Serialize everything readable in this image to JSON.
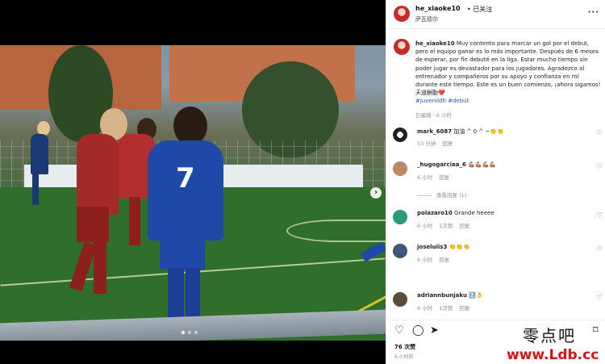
{
  "post": {
    "username": "he_xiaoke10",
    "follow_label": "已关注",
    "separator": "•",
    "location": "萨瓦德尔",
    "caption": "Muy contento para marcar un gol por el debut, pero el equipo ganar es lo más importante. Después de 6 meses de esperar, por fin debuté en la liga. Estar mucho tiempo sin poder jugar es devastador para los jugadores. Agradezco al entrenador y compañeros por su apoyo y confianza en mí durante este tiempo. Este es un buen comienzo, ¡ahora sigamos!",
    "caption_cn": "天道酬勤",
    "caption_heart": "❤️",
    "tags": "#juvenildh #debut",
    "caption_meta": "已编辑 · 6 小时",
    "more_icon": "more-horizontal-icon"
  },
  "comments": [
    {
      "user": "mark_6087",
      "text": "加油 ^ 0 ^ ~👏👏",
      "time": "53 分钟",
      "reply": "回复",
      "likes": ""
    },
    {
      "user": "_hugogarciaa_6",
      "text": "💪🏽💪🏽💪🏽💪🏽",
      "time": "6 小时",
      "reply": "回复",
      "likes": "",
      "view_replies": "查看回复 (1)"
    },
    {
      "user": "polazaro10",
      "text": "Grande heeee",
      "time": "6 小时",
      "reply": "回复",
      "likes": "1次赞"
    },
    {
      "user": "joseluiis3",
      "text": "👏👏👏",
      "time": "6 小时",
      "reply": "回复",
      "likes": ""
    },
    {
      "user": "adriannbunjaku",
      "text": "🔝👌",
      "time": "6 小时",
      "reply": "回复",
      "likes": "1次赞"
    }
  ],
  "actions": {
    "likes_count": "76 次赞",
    "posted_ago": "6 小时前"
  },
  "watermark": {
    "line1": "零点吧",
    "line2": "www.Ldb.cc"
  },
  "colors": {
    "hashtag": "#2d5ea6",
    "muted": "#8e8e8e",
    "watermark_red": "#dd1111"
  }
}
